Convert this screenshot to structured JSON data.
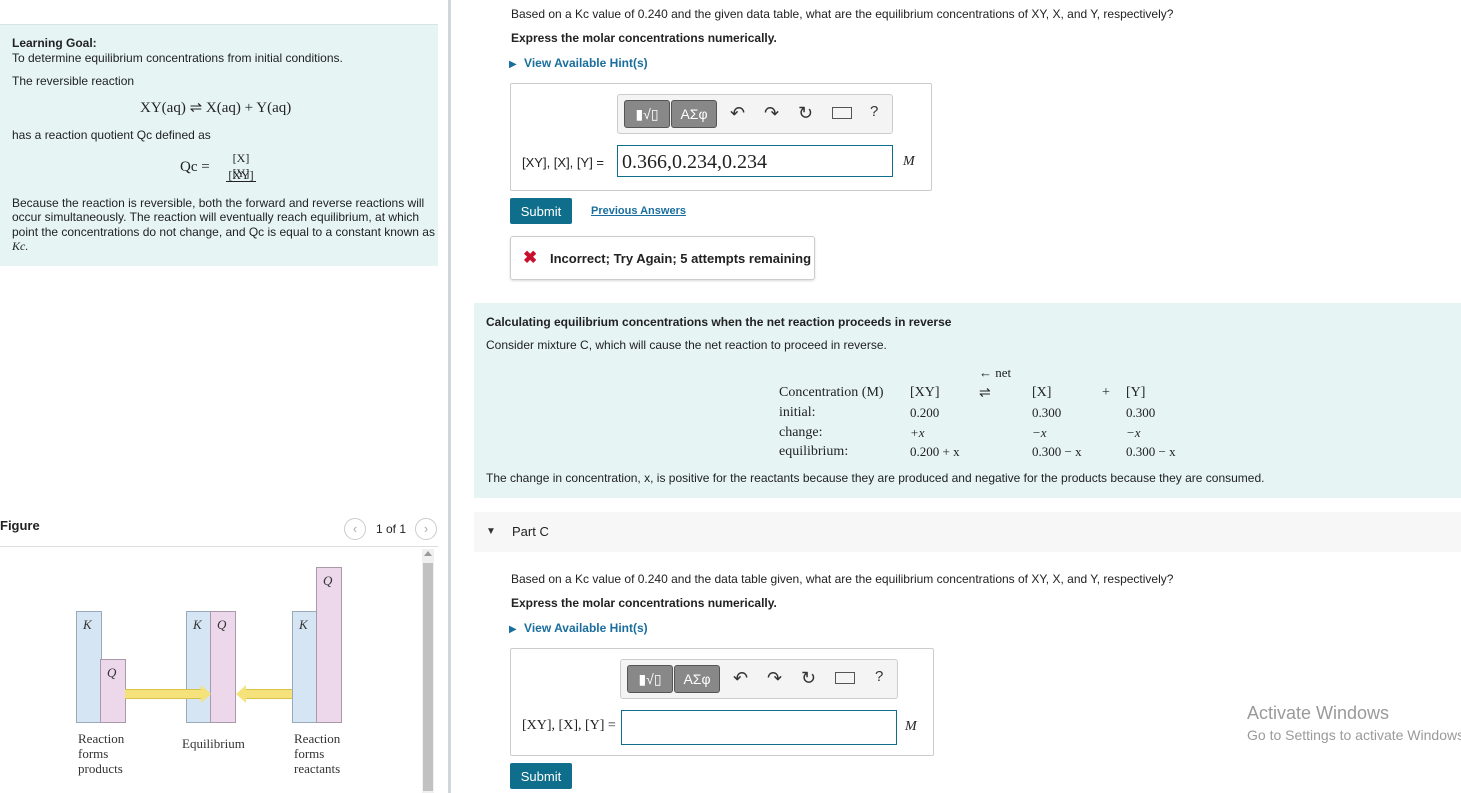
{
  "left": {
    "goal": {
      "heading": "Learning Goal:",
      "line1": "To determine equilibrium concentrations from initial conditions.",
      "line2": "The reversible reaction",
      "reaction": "XY(aq) ⇌ X(aq) + Y(aq)",
      "line3": "has a reaction quotient Qc defined as",
      "qc_lhs": "Qc =",
      "qc_num": "[X][Y]",
      "qc_den": "[XY]",
      "para": [
        "Because the reaction is reversible, both the forward and reverse reactions will",
        "occur simultaneously. The reaction will eventually reach equilibrium, at which",
        "point the concentrations do not change, and Qc is equal to a constant known as",
        "Kc."
      ]
    },
    "figure": {
      "title": "Figure",
      "pager": "1 of 1",
      "labels": {
        "k": "K",
        "q": "Q",
        "forms_products": [
          "Reaction",
          "forms",
          "products"
        ],
        "equilibrium": "Equilibrium",
        "forms_reactants": [
          "Reaction",
          "forms",
          "reactants"
        ]
      },
      "colors": {
        "k_bar": "#d5e5f3",
        "q_bar": "#ecd8ea",
        "arrow": "#f6e27a"
      }
    }
  },
  "partB": {
    "question": "Based on a Kc value of 0.240 and the given data table, what are the equilibrium concentrations of XY, X, and Y, respectively?",
    "instruction": "Express the molar concentrations numerically.",
    "hint": "View Available Hint(s)",
    "toolbar": {
      "templates": "▮√▯",
      "greek": "ΑΣφ",
      "help": "?"
    },
    "label": "[XY], [X], [Y] =",
    "value": "0.366,0.234,0.234",
    "unit": "M",
    "submit": "Submit",
    "previous": "Previous Answers",
    "feedback": "Incorrect; Try Again; 5 attempts remaining"
  },
  "info": {
    "title": "Calculating equilibrium concentrations when the net reaction proceeds in reverse",
    "subtitle": "Consider mixture C, which will cause the net reaction to proceed in reverse.",
    "net": "← net",
    "table": {
      "header": [
        "Concentration (M)",
        "[XY]",
        "⇌",
        "[X]",
        "+",
        "[Y]"
      ],
      "rows": [
        [
          "initial:",
          "0.200",
          "0.300",
          "0.300"
        ],
        [
          "change:",
          "+x",
          "−x",
          "−x"
        ],
        [
          "equilibrium:",
          "0.200 + x",
          "0.300 − x",
          "0.300 − x"
        ]
      ]
    },
    "footer": "The change in concentration, x, is positive for the reactants because they are produced and negative for the products because they are consumed."
  },
  "partC": {
    "title": "Part C",
    "question": "Based on a Kc value of 0.240 and the data table given, what are the equilibrium concentrations of XY, X, and Y, respectively?",
    "instruction": "Express the molar concentrations numerically.",
    "hint": "View Available Hint(s)",
    "label": "[XY], [X], [Y] =",
    "value": "",
    "unit": "M",
    "submit": "Submit"
  },
  "watermark": {
    "line1": "Activate Windows",
    "line2": "Go to Settings to activate Windows."
  }
}
